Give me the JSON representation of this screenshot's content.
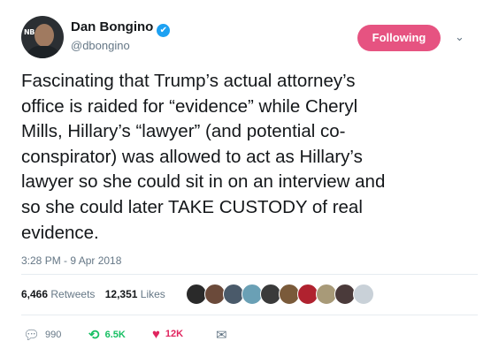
{
  "author": {
    "name": "Dan Bongino",
    "handle": "@dbongino",
    "avatar_badge": "NB",
    "verified_icon": "verified-check-icon"
  },
  "follow_button": {
    "label": "Following",
    "color": "#e0245e"
  },
  "tweet": {
    "text": "Fascinating that Trump’s actual attorney’s\noffice is raided for “evidence” while Cheryl\nMills, Hillary’s “lawyer” (and potential co-\nconspirator) was allowed to act as Hillary’s\nlawyer so she could sit in on an interview and\nso she could later TAKE CUSTODY of real\nevidence.",
    "timestamp": "3:28 PM - 9 Apr 2018"
  },
  "stats": {
    "retweets_count": "6,466",
    "retweets_label": "Retweets",
    "likes_count": "12,351",
    "likes_label": "Likes"
  },
  "likers_colors": [
    "#2a2a2a",
    "#6b4a3a",
    "#4a5a6a",
    "#6aa0b5",
    "#3a3a3a",
    "#7a5a3a",
    "#b0222f",
    "#a89a78",
    "#4a3a3a",
    "#c9d1d8"
  ],
  "actions": {
    "reply_count": "990",
    "retweet_count": "6.5K",
    "like_count": "12K"
  }
}
